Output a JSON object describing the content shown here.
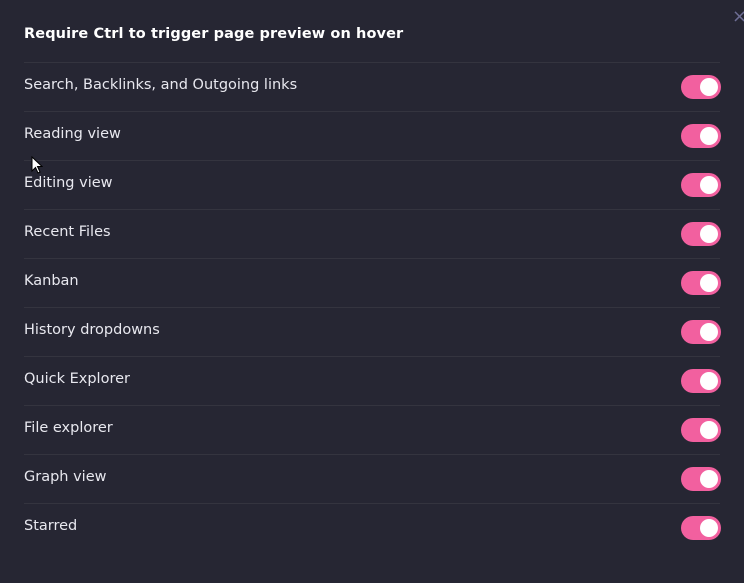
{
  "dialog": {
    "title": "Require Ctrl to trigger page preview on hover",
    "close_icon": "×"
  },
  "settings": [
    {
      "label": "Search, Backlinks, and Outgoing links",
      "enabled": true
    },
    {
      "label": "Reading view",
      "enabled": true
    },
    {
      "label": "Editing view",
      "enabled": true
    },
    {
      "label": "Recent Files",
      "enabled": true
    },
    {
      "label": "Kanban",
      "enabled": true
    },
    {
      "label": "History dropdowns",
      "enabled": true
    },
    {
      "label": "Quick Explorer",
      "enabled": true
    },
    {
      "label": "File explorer",
      "enabled": true
    },
    {
      "label": "Graph view",
      "enabled": true
    },
    {
      "label": "Starred",
      "enabled": true
    }
  ],
  "colors": {
    "background": "#262633",
    "toggle_on": "#f2609f",
    "divider": "#34343f"
  }
}
